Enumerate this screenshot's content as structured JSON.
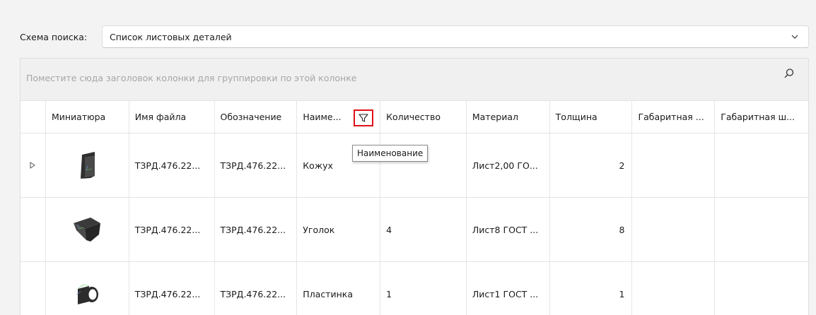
{
  "scheme": {
    "label": "Схема поиска:",
    "value": "Список листовых деталей"
  },
  "group_panel": {
    "hint": "Поместите сюда заголовок колонки для группировки по этой колонке"
  },
  "columns": [
    "Миниатюра",
    "Имя файла",
    "Обозначение",
    "Наиме...",
    "Количество",
    "Материал",
    "Толщина",
    "Габаритная ...",
    "Габаритная ш..."
  ],
  "tooltip": "Наименование",
  "rows": [
    {
      "thumb": "bracket-part",
      "file": "ТЗРД.476.22...",
      "designation": "ТЗРД.476.22...",
      "name": "Кожух",
      "qty": "",
      "material": "Лист2,00 ГО...",
      "thickness": "2",
      "dim1": "",
      "dim2": ""
    },
    {
      "thumb": "angle-part",
      "file": "ТЗРД.476.22...",
      "designation": "ТЗРД.476.22...",
      "name": "Уголок",
      "qty": "4",
      "material": "Лист8 ГОСТ ...",
      "thickness": "8",
      "dim1": "",
      "dim2": ""
    },
    {
      "thumb": "plate-part",
      "file": "ТЗРД.476.22...",
      "designation": "ТЗРД.476.22...",
      "name": "Пластинка",
      "qty": "1",
      "material": "Лист1 ГОСТ ...",
      "thickness": "1",
      "dim1": "",
      "dim2": ""
    }
  ],
  "colors": {
    "filter_highlight": "#e0101b",
    "part_dark": "#2b2b2b"
  }
}
